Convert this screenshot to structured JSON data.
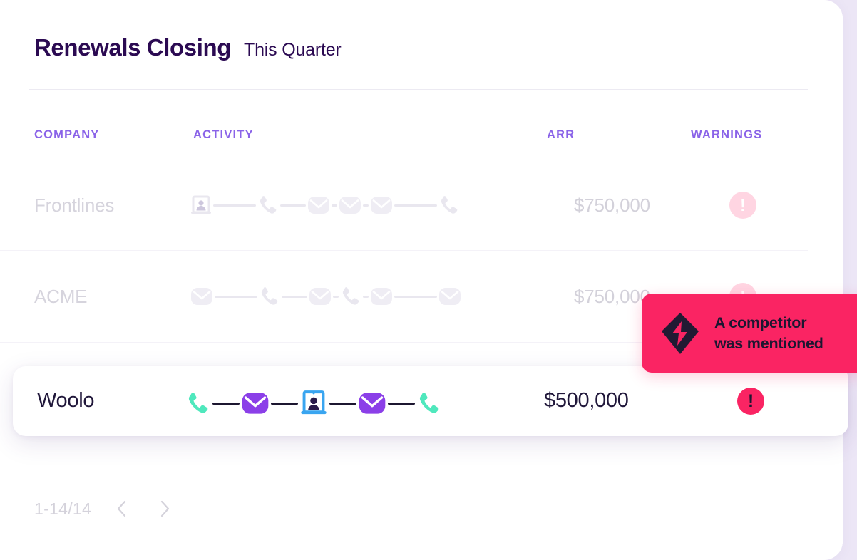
{
  "header": {
    "title": "Renewals Closing",
    "subtitle": "This Quarter"
  },
  "columns": {
    "company": "COMPANY",
    "activity": "ACTIVITY",
    "arr": "ARR",
    "warnings": "WARNINGS"
  },
  "rows": [
    {
      "company": "Frontlines",
      "arr": "$750,000",
      "warning": "!",
      "state": "faded",
      "activity": [
        "video-icon",
        "phone-icon",
        "envelope-icon",
        "envelope-icon",
        "envelope-icon",
        "phone-icon"
      ]
    },
    {
      "company": "ACME",
      "arr": "$750,000",
      "warning": "!",
      "state": "faded",
      "activity": [
        "envelope-icon",
        "phone-icon",
        "envelope-icon",
        "phone-icon",
        "envelope-icon",
        "envelope-icon"
      ]
    },
    {
      "company": "Woolo",
      "arr": "$500,000",
      "warning": "!",
      "state": "active",
      "activity": [
        "phone-icon",
        "envelope-icon",
        "video-icon",
        "envelope-icon",
        "phone-icon"
      ]
    }
  ],
  "tooltip": {
    "line1": "A competitor",
    "line2": "was mentioned",
    "icon": "competitor-alert-icon"
  },
  "pagination": {
    "range": "1-14/14",
    "prev": "chevron-left-icon",
    "next": "chevron-right-icon"
  },
  "colors": {
    "accent_purple": "#8a63e8",
    "title_purple": "#2b0a52",
    "alert_pink": "#fa2463",
    "alert_pink_faded": "#ffd5e2",
    "phone_green": "#4fe8bd",
    "envelope_purple": "#8b3fe8",
    "video_blue": "#39a5f0",
    "ink": "#1c1630",
    "muted": "#d6d4dd",
    "page_bg": "#ece6f6"
  }
}
